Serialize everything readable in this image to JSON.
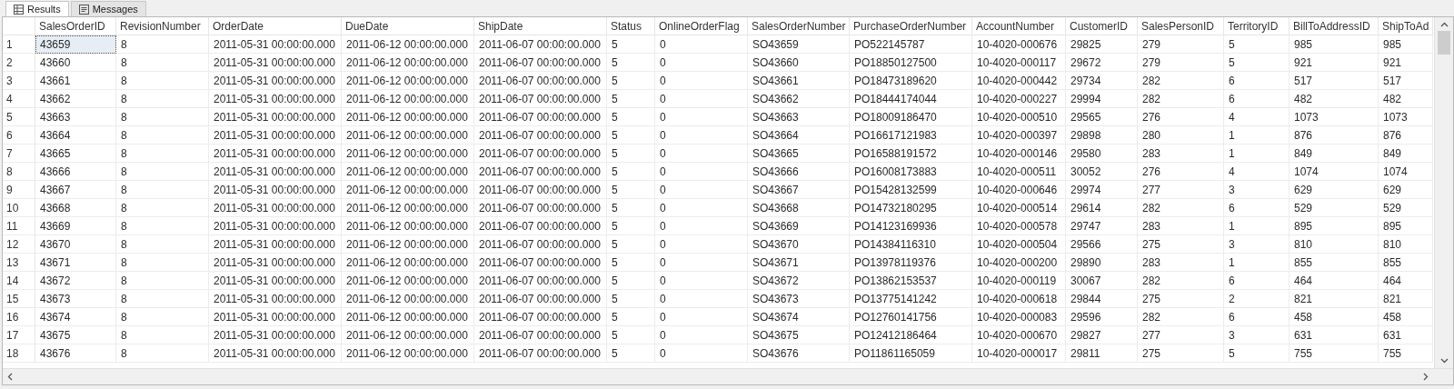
{
  "tabs": [
    {
      "label": "Results",
      "selected": true
    },
    {
      "label": "Messages",
      "selected": false
    }
  ],
  "table": {
    "columns": [
      "SalesOrderID",
      "RevisionNumber",
      "OrderDate",
      "DueDate",
      "ShipDate",
      "Status",
      "OnlineOrderFlag",
      "SalesOrderNumber",
      "PurchaseOrderNumber",
      "AccountNumber",
      "CustomerID",
      "SalesPersonID",
      "TerritoryID",
      "BillToAddressID",
      "ShipToAd"
    ],
    "rows": [
      {
        "number": "1",
        "selected": true,
        "cells": [
          "43659",
          "8",
          "2011-05-31 00:00:00.000",
          "2011-06-12 00:00:00.000",
          "2011-06-07 00:00:00.000",
          "5",
          "0",
          "SO43659",
          "PO522145787",
          "10-4020-000676",
          "29825",
          "279",
          "5",
          "985",
          "985"
        ]
      },
      {
        "number": "2",
        "selected": false,
        "cells": [
          "43660",
          "8",
          "2011-05-31 00:00:00.000",
          "2011-06-12 00:00:00.000",
          "2011-06-07 00:00:00.000",
          "5",
          "0",
          "SO43660",
          "PO18850127500",
          "10-4020-000117",
          "29672",
          "279",
          "5",
          "921",
          "921"
        ]
      },
      {
        "number": "3",
        "selected": false,
        "cells": [
          "43661",
          "8",
          "2011-05-31 00:00:00.000",
          "2011-06-12 00:00:00.000",
          "2011-06-07 00:00:00.000",
          "5",
          "0",
          "SO43661",
          "PO18473189620",
          "10-4020-000442",
          "29734",
          "282",
          "6",
          "517",
          "517"
        ]
      },
      {
        "number": "4",
        "selected": false,
        "cells": [
          "43662",
          "8",
          "2011-05-31 00:00:00.000",
          "2011-06-12 00:00:00.000",
          "2011-06-07 00:00:00.000",
          "5",
          "0",
          "SO43662",
          "PO18444174044",
          "10-4020-000227",
          "29994",
          "282",
          "6",
          "482",
          "482"
        ]
      },
      {
        "number": "5",
        "selected": false,
        "cells": [
          "43663",
          "8",
          "2011-05-31 00:00:00.000",
          "2011-06-12 00:00:00.000",
          "2011-06-07 00:00:00.000",
          "5",
          "0",
          "SO43663",
          "PO18009186470",
          "10-4020-000510",
          "29565",
          "276",
          "4",
          "1073",
          "1073"
        ]
      },
      {
        "number": "6",
        "selected": false,
        "cells": [
          "43664",
          "8",
          "2011-05-31 00:00:00.000",
          "2011-06-12 00:00:00.000",
          "2011-06-07 00:00:00.000",
          "5",
          "0",
          "SO43664",
          "PO16617121983",
          "10-4020-000397",
          "29898",
          "280",
          "1",
          "876",
          "876"
        ]
      },
      {
        "number": "7",
        "selected": false,
        "cells": [
          "43665",
          "8",
          "2011-05-31 00:00:00.000",
          "2011-06-12 00:00:00.000",
          "2011-06-07 00:00:00.000",
          "5",
          "0",
          "SO43665",
          "PO16588191572",
          "10-4020-000146",
          "29580",
          "283",
          "1",
          "849",
          "849"
        ]
      },
      {
        "number": "8",
        "selected": false,
        "cells": [
          "43666",
          "8",
          "2011-05-31 00:00:00.000",
          "2011-06-12 00:00:00.000",
          "2011-06-07 00:00:00.000",
          "5",
          "0",
          "SO43666",
          "PO16008173883",
          "10-4020-000511",
          "30052",
          "276",
          "4",
          "1074",
          "1074"
        ]
      },
      {
        "number": "9",
        "selected": false,
        "cells": [
          "43667",
          "8",
          "2011-05-31 00:00:00.000",
          "2011-06-12 00:00:00.000",
          "2011-06-07 00:00:00.000",
          "5",
          "0",
          "SO43667",
          "PO15428132599",
          "10-4020-000646",
          "29974",
          "277",
          "3",
          "629",
          "629"
        ]
      },
      {
        "number": "10",
        "selected": false,
        "cells": [
          "43668",
          "8",
          "2011-05-31 00:00:00.000",
          "2011-06-12 00:00:00.000",
          "2011-06-07 00:00:00.000",
          "5",
          "0",
          "SO43668",
          "PO14732180295",
          "10-4020-000514",
          "29614",
          "282",
          "6",
          "529",
          "529"
        ]
      },
      {
        "number": "11",
        "selected": false,
        "cells": [
          "43669",
          "8",
          "2011-05-31 00:00:00.000",
          "2011-06-12 00:00:00.000",
          "2011-06-07 00:00:00.000",
          "5",
          "0",
          "SO43669",
          "PO14123169936",
          "10-4020-000578",
          "29747",
          "283",
          "1",
          "895",
          "895"
        ]
      },
      {
        "number": "12",
        "selected": false,
        "cells": [
          "43670",
          "8",
          "2011-05-31 00:00:00.000",
          "2011-06-12 00:00:00.000",
          "2011-06-07 00:00:00.000",
          "5",
          "0",
          "SO43670",
          "PO14384116310",
          "10-4020-000504",
          "29566",
          "275",
          "3",
          "810",
          "810"
        ]
      },
      {
        "number": "13",
        "selected": false,
        "cells": [
          "43671",
          "8",
          "2011-05-31 00:00:00.000",
          "2011-06-12 00:00:00.000",
          "2011-06-07 00:00:00.000",
          "5",
          "0",
          "SO43671",
          "PO13978119376",
          "10-4020-000200",
          "29890",
          "283",
          "1",
          "855",
          "855"
        ]
      },
      {
        "number": "14",
        "selected": false,
        "cells": [
          "43672",
          "8",
          "2011-05-31 00:00:00.000",
          "2011-06-12 00:00:00.000",
          "2011-06-07 00:00:00.000",
          "5",
          "0",
          "SO43672",
          "PO13862153537",
          "10-4020-000119",
          "30067",
          "282",
          "6",
          "464",
          "464"
        ]
      },
      {
        "number": "15",
        "selected": false,
        "cells": [
          "43673",
          "8",
          "2011-05-31 00:00:00.000",
          "2011-06-12 00:00:00.000",
          "2011-06-07 00:00:00.000",
          "5",
          "0",
          "SO43673",
          "PO13775141242",
          "10-4020-000618",
          "29844",
          "275",
          "2",
          "821",
          "821"
        ]
      },
      {
        "number": "16",
        "selected": false,
        "cells": [
          "43674",
          "8",
          "2011-05-31 00:00:00.000",
          "2011-06-12 00:00:00.000",
          "2011-06-07 00:00:00.000",
          "5",
          "0",
          "SO43674",
          "PO12760141756",
          "10-4020-000083",
          "29596",
          "282",
          "6",
          "458",
          "458"
        ]
      },
      {
        "number": "17",
        "selected": false,
        "cells": [
          "43675",
          "8",
          "2011-05-31 00:00:00.000",
          "2011-06-12 00:00:00.000",
          "2011-06-07 00:00:00.000",
          "5",
          "0",
          "SO43675",
          "PO12412186464",
          "10-4020-000670",
          "29827",
          "277",
          "3",
          "631",
          "631"
        ]
      },
      {
        "number": "18",
        "selected": false,
        "cells": [
          "43676",
          "8",
          "2011-05-31 00:00:00.000",
          "2011-06-12 00:00:00.000",
          "2011-06-07 00:00:00.000",
          "5",
          "0",
          "SO43676",
          "PO11861165059",
          "10-4020-000017",
          "29811",
          "275",
          "5",
          "755",
          "755"
        ]
      }
    ]
  }
}
